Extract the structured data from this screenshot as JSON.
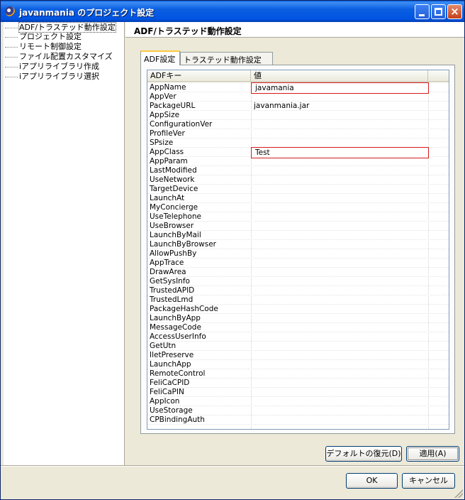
{
  "window": {
    "title": "javanmania のプロジェクト設定",
    "buttons": {
      "minimize": "minimize",
      "maximize": "maximize",
      "close": "×"
    }
  },
  "tree": {
    "items": [
      {
        "label": "ADF/トラステッド動作設定",
        "selected": true
      },
      {
        "label": "プロジェクト設定"
      },
      {
        "label": "リモート制御設定"
      },
      {
        "label": "ファイル配置カスタマイズ"
      },
      {
        "label": "iアプリライブラリ作成"
      },
      {
        "label": "iアプリライブラリ選択"
      }
    ]
  },
  "page": {
    "title": "ADF/トラステッド動作設定"
  },
  "tabs": [
    {
      "label": "ADF設定",
      "active": true
    },
    {
      "label": "トラステッド動作設定"
    }
  ],
  "table": {
    "columns": [
      "ADFキー",
      "値",
      ""
    ],
    "rows": [
      {
        "key": "AppName",
        "value": "javamania",
        "editing": true
      },
      {
        "key": "AppVer",
        "value": ""
      },
      {
        "key": "PackageURL",
        "value": "javanmania.jar"
      },
      {
        "key": "AppSize",
        "value": ""
      },
      {
        "key": "ConfigurationVer",
        "value": ""
      },
      {
        "key": "ProfileVer",
        "value": ""
      },
      {
        "key": "SPsize",
        "value": ""
      },
      {
        "key": "AppClass",
        "value": "Test",
        "editing": true
      },
      {
        "key": "AppParam",
        "value": ""
      },
      {
        "key": "LastModified",
        "value": ""
      },
      {
        "key": "UseNetwork",
        "value": ""
      },
      {
        "key": "TargetDevice",
        "value": ""
      },
      {
        "key": "LaunchAt",
        "value": ""
      },
      {
        "key": "MyConcierge",
        "value": ""
      },
      {
        "key": "UseTelephone",
        "value": ""
      },
      {
        "key": "UseBrowser",
        "value": ""
      },
      {
        "key": "LaunchByMail",
        "value": ""
      },
      {
        "key": "LaunchByBrowser",
        "value": ""
      },
      {
        "key": "AllowPushBy",
        "value": ""
      },
      {
        "key": "AppTrace",
        "value": ""
      },
      {
        "key": "DrawArea",
        "value": ""
      },
      {
        "key": "GetSysInfo",
        "value": ""
      },
      {
        "key": "TrustedAPID",
        "value": ""
      },
      {
        "key": "TrustedLmd",
        "value": ""
      },
      {
        "key": "PackageHashCode",
        "value": ""
      },
      {
        "key": "LaunchByApp",
        "value": ""
      },
      {
        "key": "MessageCode",
        "value": ""
      },
      {
        "key": "AccessUserInfo",
        "value": ""
      },
      {
        "key": "GetUtn",
        "value": ""
      },
      {
        "key": "IletPreserve",
        "value": ""
      },
      {
        "key": "LaunchApp",
        "value": ""
      },
      {
        "key": "RemoteControl",
        "value": ""
      },
      {
        "key": "FeliCaCPID",
        "value": ""
      },
      {
        "key": "FeliCaPIN",
        "value": ""
      },
      {
        "key": "AppIcon",
        "value": ""
      },
      {
        "key": "UseStorage",
        "value": ""
      },
      {
        "key": "CPBindingAuth",
        "value": ""
      }
    ]
  },
  "actions": {
    "restore_defaults": "デフォルトの復元(D)",
    "apply": "適用(A)"
  },
  "dialog": {
    "ok": "OK",
    "cancel": "キャンセル"
  },
  "colors": {
    "titlebar": "#0054e3",
    "dialog_bg": "#ece9d8",
    "edit_border": "#d41a1a",
    "button_border": "#003c74"
  }
}
